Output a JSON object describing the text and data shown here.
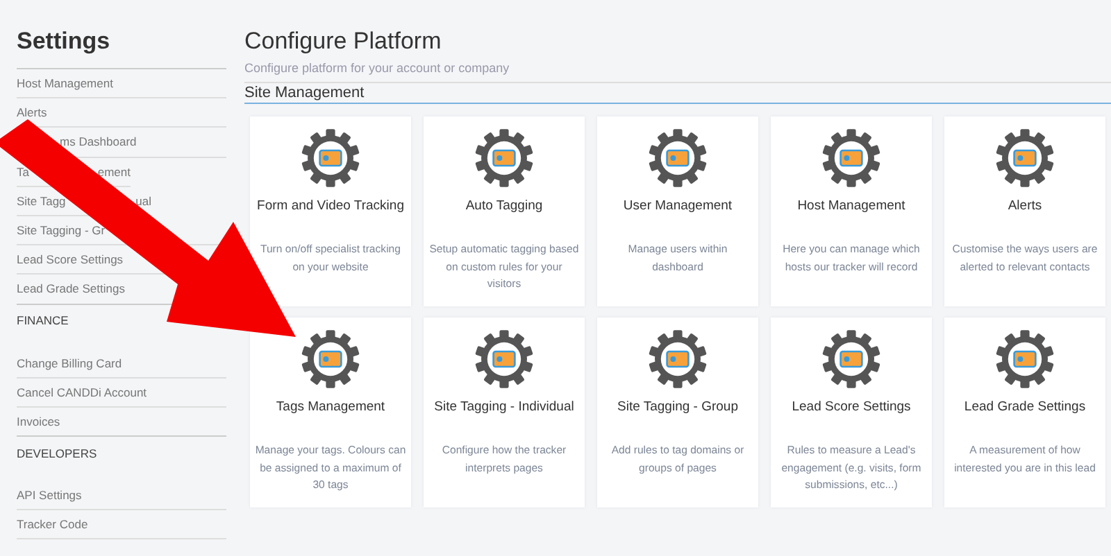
{
  "sidebar": {
    "title": "Settings",
    "items": [
      {
        "kind": "link",
        "parts": [
          "Host Management"
        ]
      },
      {
        "kind": "link",
        "parts": [
          "Alerts"
        ]
      },
      {
        "kind": "link",
        "parts": [
          "ms Dashboard"
        ]
      },
      {
        "kind": "link",
        "parts": [
          "Ta",
          "ement"
        ]
      },
      {
        "kind": "link",
        "parts": [
          "Site Tagg",
          "ual"
        ]
      },
      {
        "kind": "link",
        "parts": [
          "Site Tagging - Gr"
        ]
      },
      {
        "kind": "link",
        "parts": [
          "Lead Score Settings"
        ]
      },
      {
        "kind": "link",
        "parts": [
          "Lead Grade Settings"
        ]
      },
      {
        "kind": "section",
        "parts": [
          "FINANCE"
        ]
      },
      {
        "kind": "link",
        "parts": [
          "Change Billing Card"
        ]
      },
      {
        "kind": "link",
        "parts": [
          "Cancel CANDDi Account"
        ]
      },
      {
        "kind": "link",
        "parts": [
          "Invoices"
        ]
      },
      {
        "kind": "section",
        "parts": [
          "DEVELOPERS"
        ]
      },
      {
        "kind": "link",
        "parts": [
          "API Settings"
        ]
      },
      {
        "kind": "link",
        "parts": [
          "Tracker Code"
        ]
      }
    ]
  },
  "main": {
    "title": "Configure Platform",
    "subtitle": "Configure platform for your account or company",
    "section": "Site Management",
    "cards": [
      {
        "title": "Form and Video Tracking",
        "description": "Turn on/off specialist tracking on your website"
      },
      {
        "title": "Auto Tagging",
        "description": "Setup automatic tagging based on custom rules for your visitors"
      },
      {
        "title": "User Management",
        "description": "Manage users within dashboard"
      },
      {
        "title": "Host Management",
        "description": "Here you can manage which hosts our tracker will record"
      },
      {
        "title": "Alerts",
        "description": "Customise the ways users are alerted to relevant contacts"
      },
      {
        "title": "Tags Management",
        "description": "Manage your tags. Colours can be assigned to a maximum of 30 tags"
      },
      {
        "title": "Site Tagging - Individual",
        "description": "Configure how the tracker interprets pages"
      },
      {
        "title": "Site Tagging - Group",
        "description": "Add rules to tag domains or groups of pages"
      },
      {
        "title": "Lead Score Settings",
        "description": "Rules to measure a Lead's engagement (e.g. visits, form submissions, etc...)"
      },
      {
        "title": "Lead Grade Settings",
        "description": "A measurement of how interested you are in this lead"
      }
    ]
  }
}
